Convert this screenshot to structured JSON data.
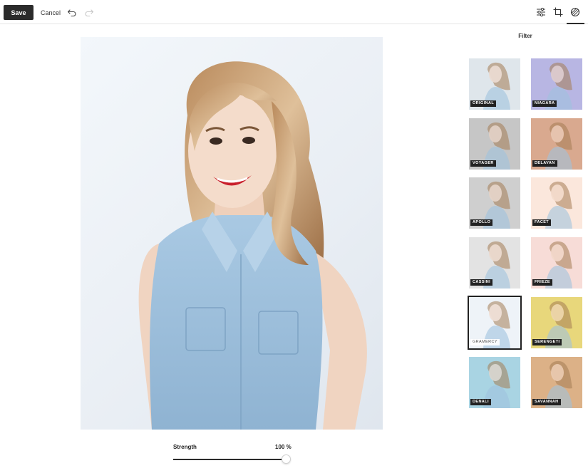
{
  "toolbar": {
    "save_label": "Save",
    "cancel_label": "Cancel",
    "icons": [
      "undo-icon",
      "redo-icon",
      "adjust-sliders-icon",
      "crop-icon",
      "filters-icon"
    ],
    "active_tab": "filters-icon"
  },
  "panel": {
    "title": "Filter",
    "selected": "GRAMERCY",
    "filters": [
      {
        "name": "ORIGINAL",
        "tint": "#dfe6ec"
      },
      {
        "name": "NIAGARA",
        "tint": "#b8b6e3"
      },
      {
        "name": "VOYAGER",
        "tint": "#c7c7c7"
      },
      {
        "name": "DELAVAN",
        "tint": "#d9a98f"
      },
      {
        "name": "APOLLO",
        "tint": "#cfcfcf"
      },
      {
        "name": "FACET",
        "tint": "#fbe7dc"
      },
      {
        "name": "CASSINI",
        "tint": "#e3e3e3"
      },
      {
        "name": "FRIEZE",
        "tint": "#f7dcd8"
      },
      {
        "name": "GRAMERCY",
        "tint": "#eef3f8"
      },
      {
        "name": "SERENGETI",
        "tint": "#e8d87c"
      },
      {
        "name": "DENALI",
        "tint": "#a9d5e3"
      },
      {
        "name": "SAVANNAH",
        "tint": "#dcb188"
      }
    ]
  },
  "strength": {
    "label": "Strength",
    "value": "100 %",
    "fraction": 1.0
  }
}
